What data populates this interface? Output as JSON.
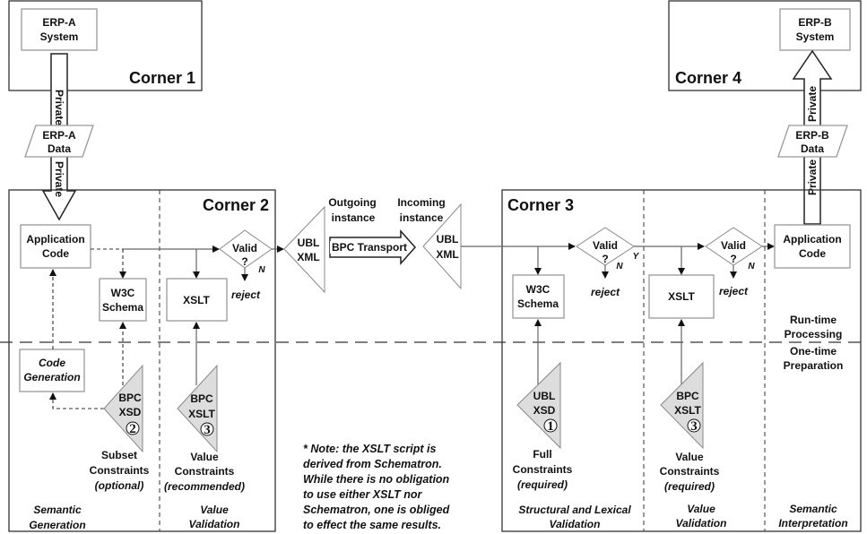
{
  "corners": {
    "c1": "Corner 1",
    "c2": "Corner 2",
    "c3": "Corner 3",
    "c4": "Corner 4"
  },
  "erp_a": {
    "system": [
      "ERP-A",
      "System"
    ],
    "data": [
      "ERP-A",
      "Data"
    ],
    "private": "Private"
  },
  "erp_b": {
    "system": [
      "ERP-B",
      "System"
    ],
    "data": [
      "ERP-B",
      "Data"
    ],
    "private": "Private"
  },
  "corner2": {
    "app_code": [
      "Application",
      "Code"
    ],
    "w3c_schema": [
      "W3C",
      "Schema"
    ],
    "xslt": "XSLT",
    "valid": [
      "Valid",
      "?"
    ],
    "no": "N",
    "reject": "reject",
    "code_generation": [
      "Code",
      "Generation"
    ],
    "bpc_xsd": [
      "BPC",
      "XSD",
      "2"
    ],
    "bpc_xslt": [
      "BPC",
      "XSLT",
      "3"
    ],
    "subset": [
      "Subset",
      "Constraints",
      "(optional)"
    ],
    "value": [
      "Value",
      "Constraints",
      "(recommended)"
    ],
    "col1": [
      "Semantic",
      "Generation"
    ],
    "col2": [
      "Value",
      "Validation"
    ]
  },
  "transport": {
    "outgoing": [
      "Outgoing",
      "instance"
    ],
    "incoming": [
      "Incoming",
      "instance"
    ],
    "ubl_xml": [
      "UBL",
      "XML"
    ],
    "label": "BPC Transport"
  },
  "corner3": {
    "w3c_schema": [
      "W3C",
      "Schema"
    ],
    "valid": [
      "Valid",
      "?"
    ],
    "yes": "Y",
    "no": "N",
    "reject": "reject",
    "xslt": "XSLT",
    "app_code": [
      "Application",
      "Code"
    ],
    "ubl_xsd": [
      "UBL",
      "XSD",
      "1"
    ],
    "bpc_xslt": [
      "BPC",
      "XSLT",
      "3"
    ],
    "full": [
      "Full",
      "Constraints",
      "(required)"
    ],
    "value": [
      "Value",
      "Constraints",
      "(required)"
    ],
    "runtime": [
      "Run-time",
      "Processing"
    ],
    "onetime": [
      "One-time",
      "Preparation"
    ],
    "col1": [
      "Structural and Lexical",
      "Validation"
    ],
    "col2": [
      "Value",
      "Validation"
    ],
    "col3": [
      "Semantic",
      "Interpretation"
    ]
  },
  "note": [
    "* Note: the XSLT script is",
    "derived from Schematron.",
    "While there is no obligation",
    "to use either XSLT nor",
    "Schematron, one is obliged",
    "to effect the same results."
  ]
}
